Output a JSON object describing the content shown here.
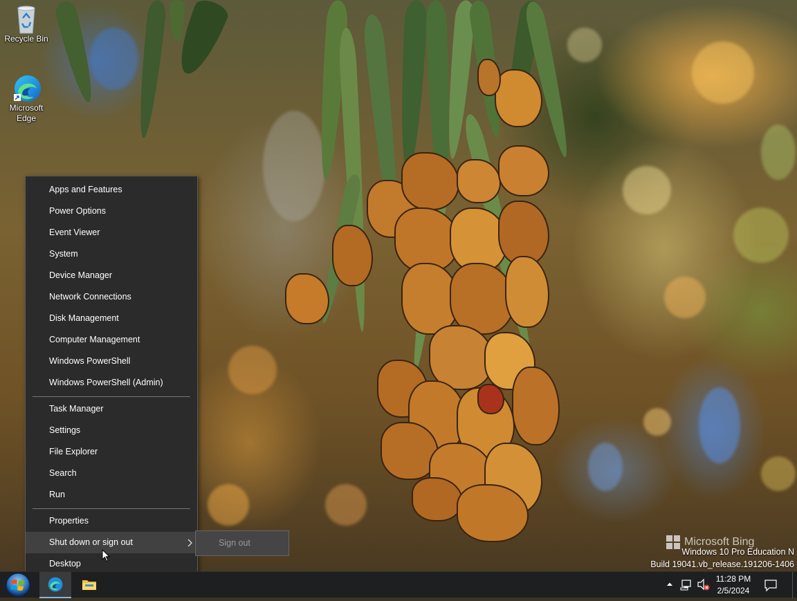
{
  "desktop": {
    "icons": [
      {
        "label": "Recycle Bin",
        "icon": "recycle-bin-icon"
      },
      {
        "label": "Microsoft\nEdge",
        "label_line1": "Microsoft",
        "label_line2": "Edge",
        "icon": "edge-icon"
      }
    ]
  },
  "context_menu": {
    "group1": [
      {
        "label": "Apps and Features"
      },
      {
        "label": "Power Options"
      },
      {
        "label": "Event Viewer"
      },
      {
        "label": "System"
      },
      {
        "label": "Device Manager"
      },
      {
        "label": "Network Connections"
      },
      {
        "label": "Disk Management"
      },
      {
        "label": "Computer Management"
      },
      {
        "label": "Windows PowerShell"
      },
      {
        "label": "Windows PowerShell (Admin)"
      }
    ],
    "group2": [
      {
        "label": "Task Manager"
      },
      {
        "label": "Settings"
      },
      {
        "label": "File Explorer"
      },
      {
        "label": "Search"
      },
      {
        "label": "Run"
      }
    ],
    "group3": [
      {
        "label": "Properties"
      },
      {
        "label": "Shut down or sign out",
        "has_submenu": true,
        "highlighted": true
      },
      {
        "label": "Desktop"
      }
    ],
    "submenu": {
      "label": "Sign out"
    }
  },
  "watermark": {
    "brand": "Microsoft Bing",
    "edition": "Windows 10 Pro Education N",
    "build": "Build 19041.vb_release.191206-1406"
  },
  "taskbar": {
    "start_icon": "windows-start-orb-icon",
    "pinned": [
      {
        "icon": "edge-icon",
        "active": true
      },
      {
        "icon": "file-explorer-icon",
        "active": false
      }
    ],
    "tray": {
      "icons": [
        "chevron-up-icon",
        "network-icon",
        "volume-muted-icon"
      ],
      "time": "11:28 PM",
      "date": "2/5/2024",
      "notification_icon": "action-center-icon"
    }
  },
  "colors": {
    "menu_bg": "#2b2b2b",
    "menu_hover": "#414141",
    "submenu_bg": "#454545",
    "taskbar_bg": "#1e1f20"
  }
}
